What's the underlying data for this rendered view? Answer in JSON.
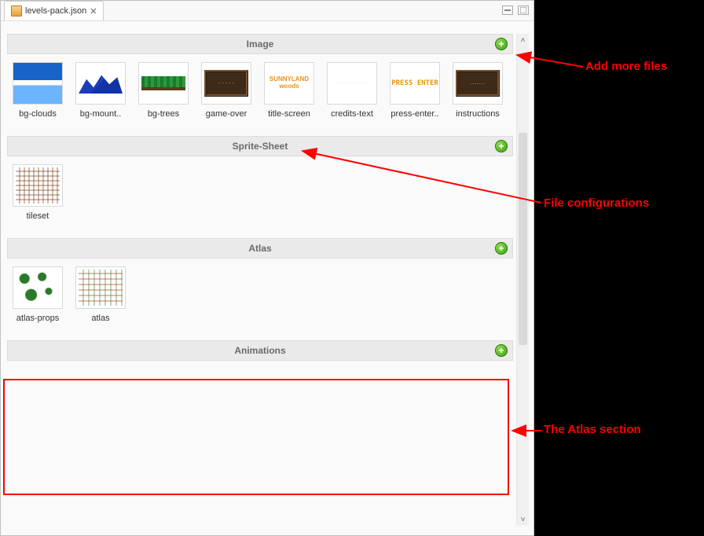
{
  "tab": {
    "filename": "levels-pack.json"
  },
  "sections": {
    "image": {
      "title": "Image",
      "items": [
        {
          "label": "bg-clouds"
        },
        {
          "label": "bg-mount.."
        },
        {
          "label": "bg-trees"
        },
        {
          "label": "game-over"
        },
        {
          "label": "title-screen"
        },
        {
          "label": "credits-text"
        },
        {
          "label": "press-enter.."
        },
        {
          "label": "instructions"
        }
      ]
    },
    "spritesheet": {
      "title": "Sprite-Sheet",
      "items": [
        {
          "label": "tileset"
        }
      ]
    },
    "atlas": {
      "title": "Atlas",
      "items": [
        {
          "label": "atlas-props"
        },
        {
          "label": "atlas"
        }
      ]
    },
    "animations": {
      "title": "Animations"
    }
  },
  "thumb_text": {
    "title_screen": "SUNNYLAND\nwoods",
    "credits": "· · · · · · · ·",
    "press_enter": "PRESS ENTER"
  },
  "annotations": {
    "add_files": "Add more files",
    "file_configs": "File configurations",
    "atlas_section": "The Atlas section"
  }
}
